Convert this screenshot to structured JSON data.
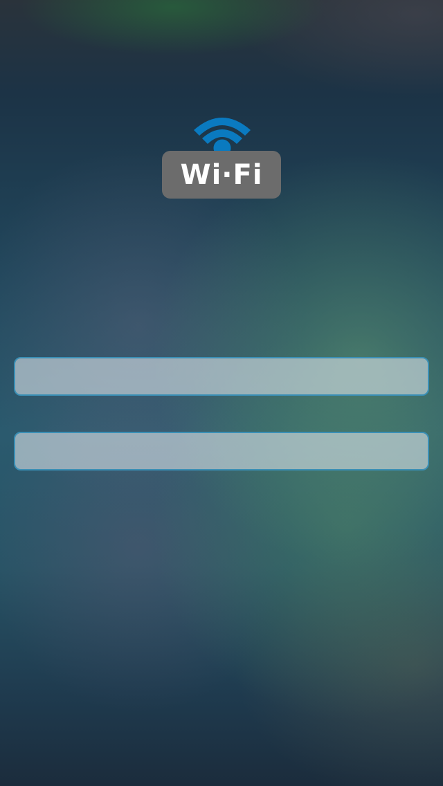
{
  "logo": {
    "icon": "wifi-icon",
    "label": "Wi·Fi",
    "accent_color": "#0a7ac0",
    "badge_color": "#6c6c6c"
  },
  "form": {
    "field_1": {
      "value": "",
      "placeholder": ""
    },
    "field_2": {
      "value": "",
      "placeholder": ""
    },
    "border_color": "#3a8fb5"
  }
}
